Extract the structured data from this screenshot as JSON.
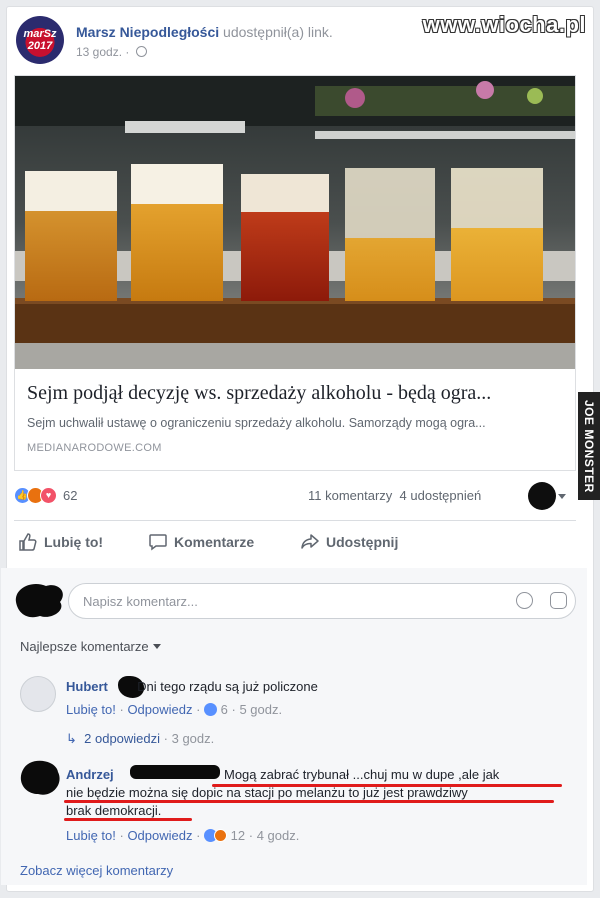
{
  "watermark": "www.wiocha.pl",
  "side_watermark": "JOE MONSTER",
  "post": {
    "page_avatar_text": "marSz 2017",
    "page_name": "Marsz Niepodległości",
    "action": "udostępnił(a)",
    "action_link": "link.",
    "time": "13 godz.",
    "privacy_icon": "globe-icon"
  },
  "link_preview": {
    "title": "Sejm podjął decyzję ws. sprzedaży alkoholu - będą ogra...",
    "description": "Sejm uchwalił ustawę o ograniczeniu sprzedaży alkoholu. Samorządy mogą ogra...",
    "domain": "MEDIANARODOWE.COM"
  },
  "stats": {
    "reaction_icons": [
      "like-icon",
      "angry-icon",
      "love-icon"
    ],
    "reaction_count": "62",
    "comments": "11 komentarzy",
    "shares": "4 udostępnień"
  },
  "actions": {
    "like": "Lubię to!",
    "comment": "Komentarze",
    "share": "Udostępnij"
  },
  "composer": {
    "placeholder": "Napisz komentarz..."
  },
  "sort_label": "Najlepsze komentarze",
  "comments": [
    {
      "name": "Hubert",
      "text": "Dni tego rządu są już policzone",
      "like": "Lubię to!",
      "reply": "Odpowiedz",
      "reaction_count": "6",
      "time": "5 godz.",
      "replies_label": "2 odpowiedzi",
      "replies_time": "3 godz."
    },
    {
      "name": "Andrzej",
      "text_line1": "Mogą zabrać trybunał ...chuj mu w dupe ,ale jak",
      "text_line2": "nie będzie można się dopic na stacji po melanżu to już jest prawdziwy",
      "text_line3": "brak demokracji.",
      "like": "Lubię to!",
      "reply": "Odpowiedz",
      "reaction_count": "12",
      "time": "4 godz."
    }
  ],
  "more_comments": "Zobacz więcej komentarzy",
  "colors": {
    "link_blue": "#365899",
    "action_blue": "#4267b2",
    "annotation_red": "#e01b1b"
  }
}
